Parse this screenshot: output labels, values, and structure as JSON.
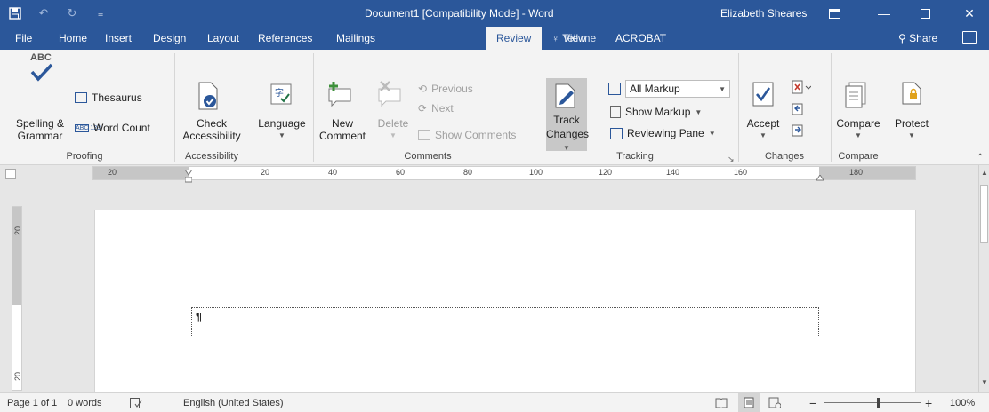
{
  "title_bar": {
    "document_title": "Document1 [Compatibility Mode]  -  Word",
    "user": "Elizabeth Sheares",
    "qat": [
      "save-icon",
      "undo-icon",
      "redo-icon",
      "customize-qat-icon"
    ]
  },
  "tabs": [
    "File",
    "Home",
    "Insert",
    "Design",
    "Layout",
    "References",
    "Mailings",
    "Review",
    "View",
    "ACROBAT"
  ],
  "active_tab": "Review",
  "tell_me": "Tell me",
  "share": "Share",
  "ribbon": {
    "proofing": {
      "label": "Proofing",
      "spelling_top": "ABC",
      "spelling_line1": "Spelling &",
      "spelling_line2": "Grammar",
      "thesaurus": "Thesaurus",
      "word_count": "Word Count",
      "word_count_icon_text": "ABC 123"
    },
    "accessibility": {
      "label": "Accessibility",
      "check_line1": "Check",
      "check_line2": "Accessibility"
    },
    "language": {
      "label": "Language"
    },
    "comments": {
      "label": "Comments",
      "new_line1": "New",
      "new_line2": "Comment",
      "delete": "Delete",
      "previous": "Previous",
      "next": "Next",
      "show_comments": "Show Comments"
    },
    "tracking": {
      "label": "Tracking",
      "track_line1": "Track",
      "track_line2": "Changes",
      "markup_select": "All Markup",
      "show_markup": "Show Markup",
      "reviewing_pane": "Reviewing Pane"
    },
    "changes": {
      "label": "Changes",
      "accept": "Accept"
    },
    "compare": {
      "label": "Compare",
      "compare": "Compare"
    },
    "protect": {
      "protect": "Protect"
    }
  },
  "ruler": {
    "labels": [
      "20",
      "20",
      "40",
      "60",
      "80",
      "100",
      "120",
      "140",
      "160",
      "180"
    ],
    "vertical_labels": [
      "20",
      "20"
    ]
  },
  "document": {
    "pilcrow": "¶"
  },
  "status_bar": {
    "page": "Page 1 of 1",
    "words": "0 words",
    "language": "English (United States)",
    "zoom": "100%",
    "zoom_out": "−",
    "zoom_in": "+"
  },
  "colors": {
    "title_bar": "#2b579a",
    "ribbon": "#f3f3f3",
    "workspace": "#e6e6e6"
  }
}
